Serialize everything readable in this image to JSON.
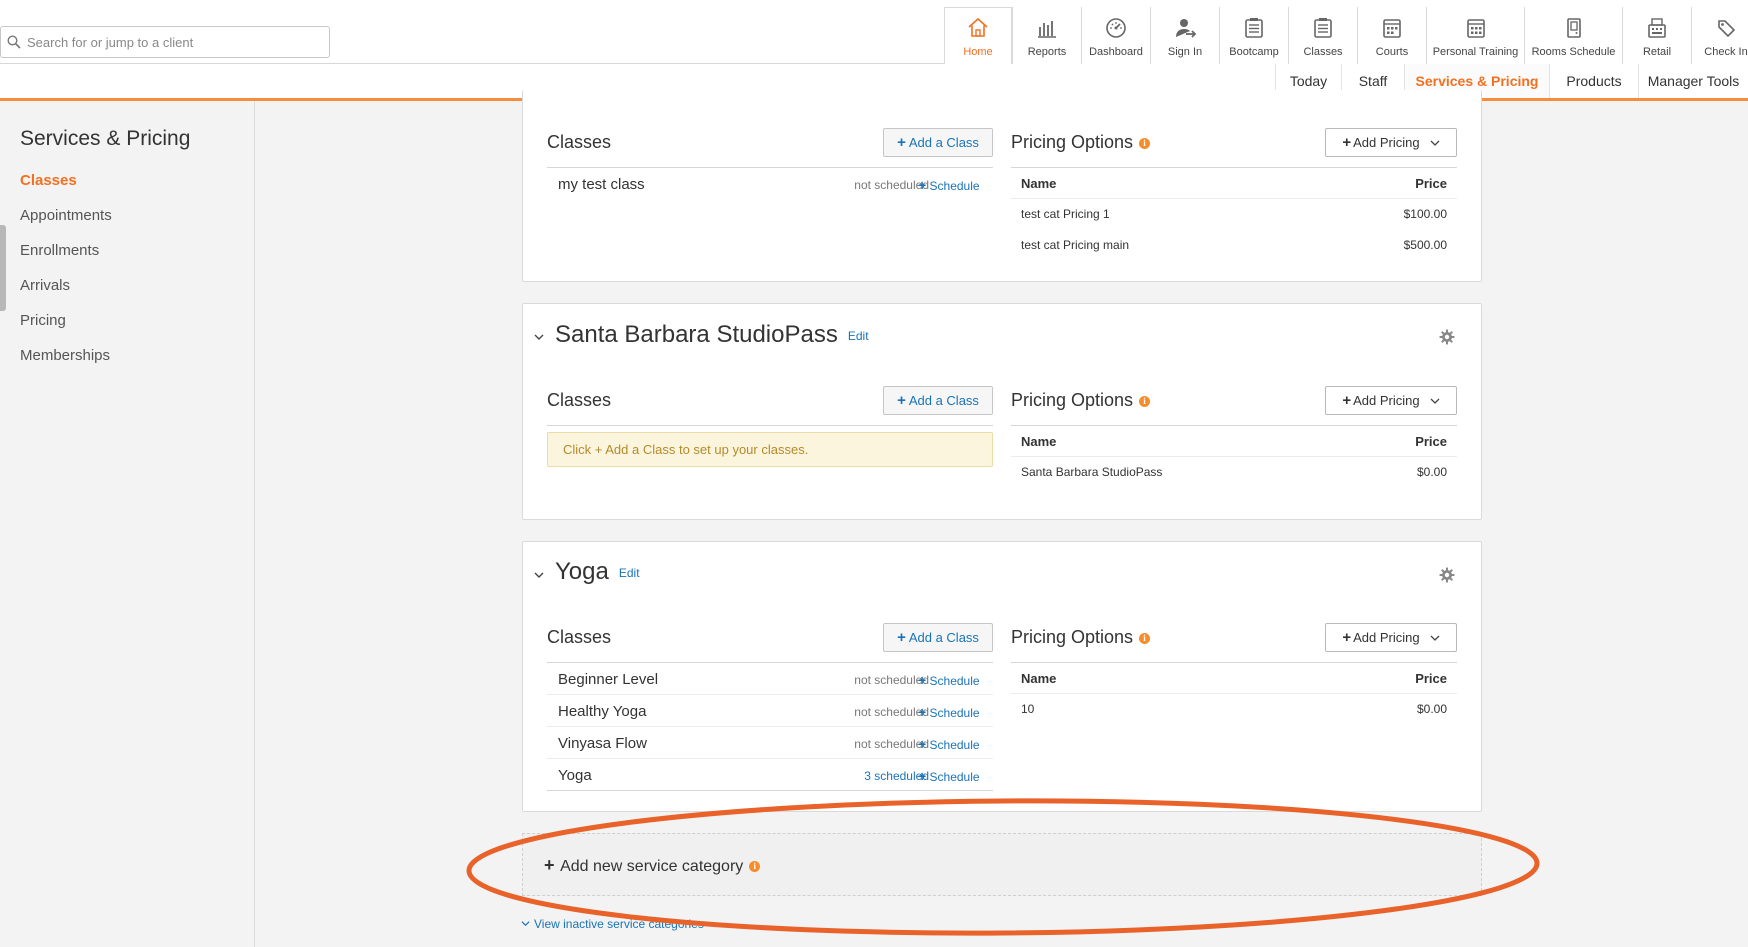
{
  "search": {
    "placeholder": "Search for or jump to a client"
  },
  "topnav": [
    {
      "label": "Home",
      "icon": "home-icon",
      "active": true
    },
    {
      "label": "Reports",
      "icon": "reports-icon"
    },
    {
      "label": "Dashboard",
      "icon": "dashboard-icon"
    },
    {
      "label": "Sign In",
      "icon": "sign-in-icon"
    },
    {
      "label": "Bootcamp",
      "icon": "bootcamp-icon"
    },
    {
      "label": "Classes",
      "icon": "classes-icon"
    },
    {
      "label": "Courts",
      "icon": "courts-icon"
    },
    {
      "label": "Personal Training",
      "icon": "personal-training-icon"
    },
    {
      "label": "Rooms Schedule",
      "icon": "rooms-schedule-icon"
    },
    {
      "label": "Retail",
      "icon": "retail-icon"
    },
    {
      "label": "Check In",
      "icon": "check-in-icon"
    }
  ],
  "subnav": [
    {
      "label": "Today"
    },
    {
      "label": "Staff"
    },
    {
      "label": "Services & Pricing",
      "active": true
    },
    {
      "label": "Products"
    },
    {
      "label": "Manager Tools"
    }
  ],
  "sidebar": {
    "title": "Services & Pricing",
    "items": [
      {
        "label": "Classes",
        "active": true
      },
      {
        "label": "Appointments"
      },
      {
        "label": "Enrollments"
      },
      {
        "label": "Arrivals"
      },
      {
        "label": "Pricing"
      },
      {
        "label": "Memberships"
      }
    ]
  },
  "labels": {
    "classes_heading": "Classes",
    "pricing_heading": "Pricing Options",
    "add_class": "Add a Class",
    "add_pricing": "Add Pricing",
    "edit": "Edit",
    "schedule": "Schedule",
    "col_name": "Name",
    "col_price": "Price",
    "info_glyph": "i",
    "plus_glyph": "+"
  },
  "categories": [
    {
      "title": "",
      "classes": [
        {
          "name": "my test class",
          "status": "not scheduled"
        }
      ],
      "pricing": [
        {
          "name": "test cat Pricing 1",
          "price": "$100.00"
        },
        {
          "name": "test cat Pricing main",
          "price": "$500.00"
        }
      ]
    },
    {
      "title": "Santa Barbara StudioPass",
      "empty_notice": "Click + Add a Class to set up your classes.",
      "classes": [],
      "pricing": [
        {
          "name": "Santa Barbara StudioPass",
          "price": "$0.00"
        }
      ]
    },
    {
      "title": "Yoga",
      "classes": [
        {
          "name": "Beginner Level",
          "status": "not scheduled"
        },
        {
          "name": "Healthy Yoga",
          "status": "not scheduled"
        },
        {
          "name": "Vinyasa Flow",
          "status": "not scheduled"
        },
        {
          "name": "Yoga",
          "status": "3 scheduled"
        }
      ],
      "pricing": [
        {
          "name": "10",
          "price": "$0.00"
        }
      ]
    }
  ],
  "add_category": {
    "label": "Add new service category"
  },
  "view_inactive": {
    "label": "View inactive service categories"
  },
  "colors": {
    "accent": "#f37021",
    "link": "#1a73b8",
    "annotation": "#e8622a"
  }
}
